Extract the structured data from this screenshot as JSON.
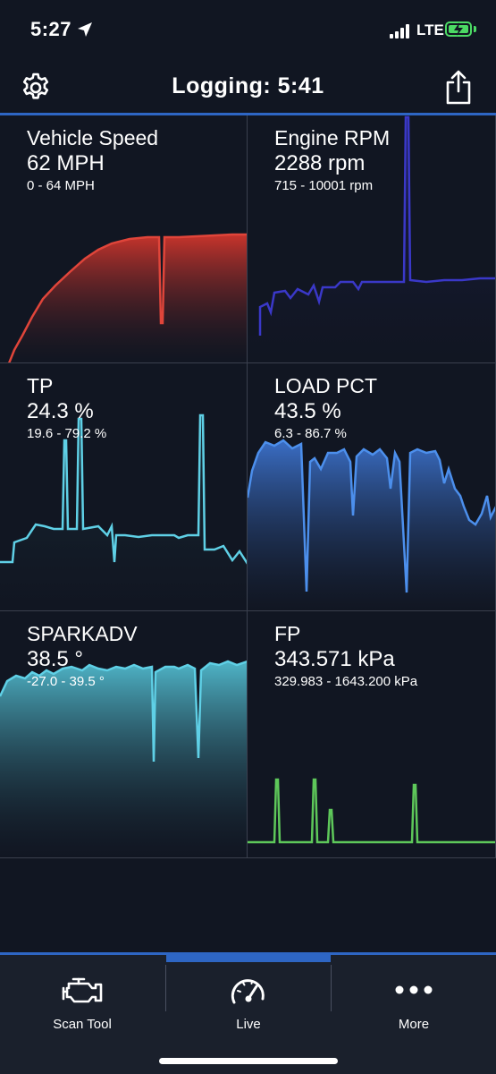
{
  "status_bar": {
    "time": "5:27",
    "carrier": "LTE"
  },
  "header": {
    "title": "Logging:  5:41"
  },
  "gauges": [
    {
      "name": "Vehicle Speed",
      "value": "62 MPH",
      "range": "0 - 64 MPH",
      "color": "#e0453a",
      "fill_top": "#c8342c"
    },
    {
      "name": "Engine RPM",
      "value": "2288 rpm",
      "range": "715 - 10001 rpm",
      "color": "#3a38c8",
      "fill_top": "#1c1e52"
    },
    {
      "name": "TP",
      "value": "24.3 %",
      "range": "19.6 - 79.2 %",
      "color": "#5fd0e6",
      "fill_top": "#1d3a44"
    },
    {
      "name": "LOAD PCT",
      "value": "43.5 %",
      "range": "6.3 - 86.7 %",
      "color": "#4c8fec",
      "fill_top": "#3f78d8"
    },
    {
      "name": "SPARKADV",
      "value": "38.5 °",
      "range": "-27.0 - 39.5 °",
      "color": "#5fd0e6",
      "fill_top": "#4fb5c8"
    },
    {
      "name": "FP",
      "value": "343.571 kPa",
      "range": "329.983 - 1643.200 kPa",
      "color": "#5ec85a",
      "fill_top": ""
    }
  ],
  "tabs": [
    {
      "label": "Scan Tool",
      "icon": "engine-icon"
    },
    {
      "label": "Live",
      "icon": "gauge-icon",
      "active": true
    },
    {
      "label": "More",
      "icon": "more-icon"
    }
  ]
}
